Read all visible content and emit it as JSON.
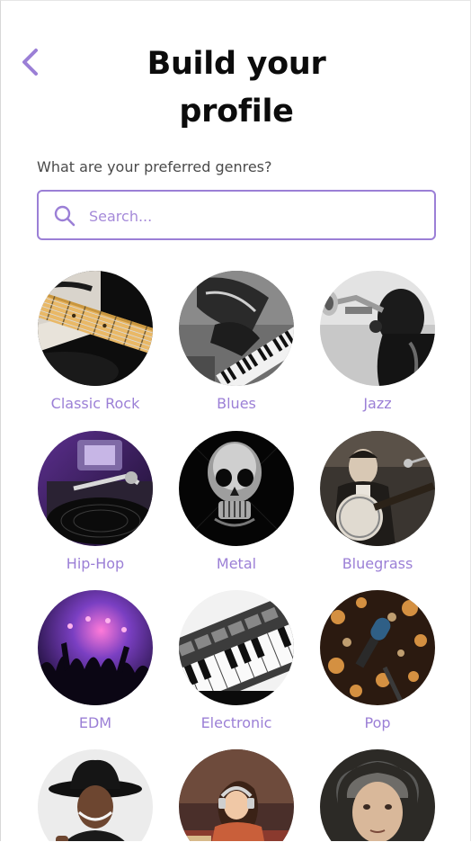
{
  "header": {
    "title_line1": "Build your",
    "title_line2": "profile",
    "back_icon": "chevron-left-icon"
  },
  "prompt": "What are your preferred genres?",
  "search": {
    "placeholder": "Search...",
    "value": "",
    "icon": "search-icon"
  },
  "colors": {
    "accent": "#9b7fd6",
    "title": "#0c0c0c",
    "prompt": "#4a4a4a"
  },
  "genres": [
    {
      "label": "Classic Rock",
      "image": "electric-guitar"
    },
    {
      "label": "Blues",
      "image": "piano-player"
    },
    {
      "label": "Jazz",
      "image": "trumpet-player"
    },
    {
      "label": "Hip-Hop",
      "image": "turntable"
    },
    {
      "label": "Metal",
      "image": "chrome-skull"
    },
    {
      "label": "Bluegrass",
      "image": "banjo-player"
    },
    {
      "label": "EDM",
      "image": "concert-crowd"
    },
    {
      "label": "Electronic",
      "image": "synth-keyboard"
    },
    {
      "label": "Pop",
      "image": "microphone-bokeh"
    },
    {
      "label": "",
      "image": "cowboy-hat-artist"
    },
    {
      "label": "",
      "image": "lofi-girl"
    },
    {
      "label": "",
      "image": "beethoven-portrait"
    }
  ]
}
